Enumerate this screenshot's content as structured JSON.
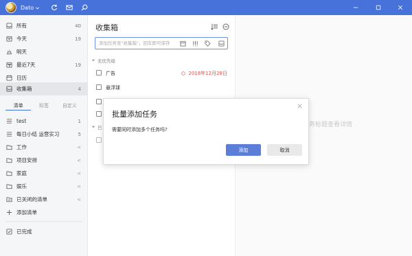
{
  "titlebar": {
    "user": "Dato",
    "bg": "#4772D9"
  },
  "sidebar": {
    "smart_lists": [
      {
        "label": "所有",
        "count": "40",
        "icon": "inbox-icon"
      },
      {
        "label": "今天",
        "count": "19",
        "icon": "calendar-today-icon"
      },
      {
        "label": "明天",
        "count": "",
        "icon": "sun-icon"
      },
      {
        "label": "最近7天",
        "count": "19",
        "icon": "calendar-week-icon"
      },
      {
        "label": "日历",
        "count": "",
        "icon": "calendar-icon"
      },
      {
        "label": "收集箱",
        "count": "4",
        "icon": "inbox-tray-icon"
      }
    ],
    "tabs": [
      "清单",
      "标签",
      "自定义"
    ],
    "lists": [
      {
        "label": "test",
        "count": "1",
        "arrow": ""
      },
      {
        "label": "每日小结 运营实习",
        "count": "5",
        "arrow": ""
      },
      {
        "label": "工作",
        "count": "",
        "arrow": "<"
      },
      {
        "label": "项目安排",
        "count": "",
        "arrow": "<"
      },
      {
        "label": "家庭",
        "count": "",
        "arrow": "<"
      },
      {
        "label": "娱乐",
        "count": "",
        "arrow": "<"
      },
      {
        "label": "已关闭的清单",
        "count": "",
        "arrow": "<"
      }
    ],
    "add_list": "添加清单",
    "completed": "已完成"
  },
  "main": {
    "title": "收集箱",
    "add_placeholder": "添加任务至\"收集箱\"，回车即可保存",
    "section": "无优先级",
    "tasks": [
      {
        "label": "广告",
        "date": "2018年12月28日"
      },
      {
        "label": "悬浮球",
        "date": ""
      }
    ],
    "section2_partial": "已",
    "accent": "#E35050"
  },
  "detail": {
    "hint": "务标题查看详情"
  },
  "dialog": {
    "title": "批量添加任务",
    "message": "需要同时添加多个任务吗?",
    "confirm": "添加",
    "cancel": "取消",
    "primary_color": "#5B7FD8"
  }
}
